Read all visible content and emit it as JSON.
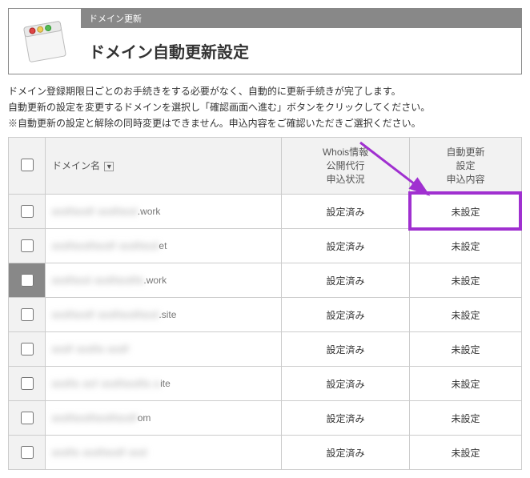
{
  "header": {
    "tab": "ドメイン更新",
    "title": "ドメイン自動更新設定"
  },
  "intro": {
    "line1": "ドメイン登録期限日ごとのお手続きをする必要がなく、自動的に更新手続きが完了します。",
    "line2": "自動更新の設定を変更するドメインを選択し「確認画面へ進む」ボタンをクリックしてください。",
    "line3": "※自動更新の設定と解除の同時変更はできません。申込内容をご確認いただきご選択ください。"
  },
  "table": {
    "headers": {
      "domain": "ドメイン名",
      "whois": "Whois情報\n公開代行\n申込状況",
      "auto": "自動更新\n設定\n申込内容"
    },
    "rows": [
      {
        "domain_blur": "asdfasdf asdfasd",
        "domain_clear": ".work",
        "whois": "設定済み",
        "auto": "未設定",
        "selected": false
      },
      {
        "domain_blur": "asdfasdfasdf asdfasd",
        "domain_clear": "et",
        "whois": "設定済み",
        "auto": "未設定",
        "selected": false
      },
      {
        "domain_blur": "asdfasd asdfasdfa",
        "domain_clear": ".work",
        "whois": "設定済み",
        "auto": "未設定",
        "selected": true
      },
      {
        "domain_blur": "asdfasdf asdfasdfasd",
        "domain_clear": ".site",
        "whois": "設定済み",
        "auto": "未設定",
        "selected": false
      },
      {
        "domain_blur": "asdf asdfa asdf",
        "domain_clear": "",
        "whois": "設定済み",
        "auto": "未設定",
        "selected": false
      },
      {
        "domain_blur": "asdfa asf asdfasdfa a",
        "domain_clear": "ite",
        "whois": "設定済み",
        "auto": "未設定",
        "selected": false
      },
      {
        "domain_blur": "asdfasdfasdfasdf",
        "domain_clear": "om",
        "whois": "設定済み",
        "auto": "未設定",
        "selected": false
      },
      {
        "domain_blur": "asdfa asdfasdf asd",
        "domain_clear": "",
        "whois": "設定済み",
        "auto": "未設定",
        "selected": false
      }
    ]
  }
}
